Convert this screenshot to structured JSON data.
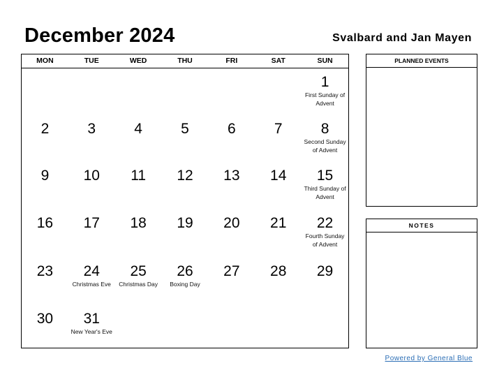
{
  "header": {
    "title": "December 2024",
    "country": "Svalbard and Jan Mayen"
  },
  "calendar": {
    "weekdays": [
      "MON",
      "TUE",
      "WED",
      "THU",
      "FRI",
      "SAT",
      "SUN"
    ],
    "weeks": [
      [
        {
          "day": ""
        },
        {
          "day": ""
        },
        {
          "day": ""
        },
        {
          "day": ""
        },
        {
          "day": ""
        },
        {
          "day": ""
        },
        {
          "day": "1",
          "event": "First Sunday of Advent"
        }
      ],
      [
        {
          "day": "2"
        },
        {
          "day": "3"
        },
        {
          "day": "4"
        },
        {
          "day": "5"
        },
        {
          "day": "6"
        },
        {
          "day": "7"
        },
        {
          "day": "8",
          "event": "Second Sunday of Advent"
        }
      ],
      [
        {
          "day": "9"
        },
        {
          "day": "10"
        },
        {
          "day": "11"
        },
        {
          "day": "12"
        },
        {
          "day": "13"
        },
        {
          "day": "14"
        },
        {
          "day": "15",
          "event": "Third Sunday of Advent"
        }
      ],
      [
        {
          "day": "16"
        },
        {
          "day": "17"
        },
        {
          "day": "18"
        },
        {
          "day": "19"
        },
        {
          "day": "20"
        },
        {
          "day": "21"
        },
        {
          "day": "22",
          "event": "Fourth Sunday of Advent"
        }
      ],
      [
        {
          "day": "23"
        },
        {
          "day": "24",
          "event": "Christmas Eve"
        },
        {
          "day": "25",
          "event": "Christmas Day"
        },
        {
          "day": "26",
          "event": "Boxing Day"
        },
        {
          "day": "27"
        },
        {
          "day": "28"
        },
        {
          "day": "29"
        }
      ],
      [
        {
          "day": "30"
        },
        {
          "day": "31",
          "event": "New Year's Eve"
        },
        {
          "day": ""
        },
        {
          "day": ""
        },
        {
          "day": ""
        },
        {
          "day": ""
        },
        {
          "day": ""
        }
      ]
    ]
  },
  "sidebar": {
    "planned_events_label": "PLANNED EVENTS",
    "notes_label": "NOTES"
  },
  "footer": {
    "powered_by": "Powered by General Blue",
    "link_color": "#2a6db5"
  }
}
